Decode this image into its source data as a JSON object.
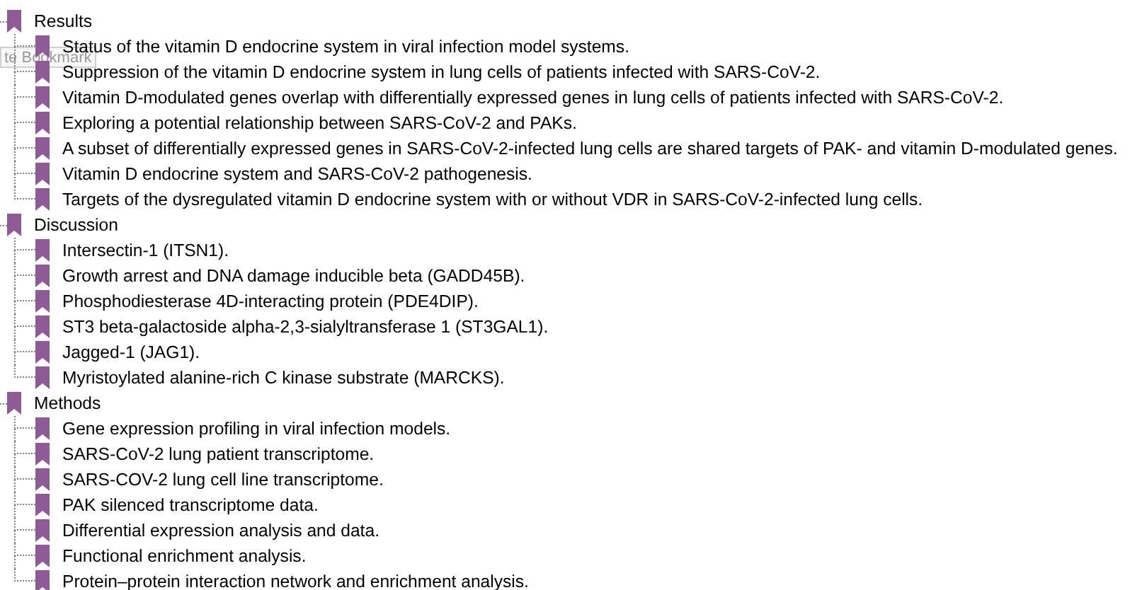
{
  "tooltip": {
    "text": "te Bookmark"
  },
  "bookmarks": [
    {
      "label": "Results",
      "children": [
        {
          "label": "Status of the vitamin D endocrine system in viral infection model systems."
        },
        {
          "label": "Suppression of the vitamin D endocrine system in lung cells of patients infected with SARS-CoV-2."
        },
        {
          "label": "Vitamin D-modulated genes overlap with differentially expressed genes in lung cells of patients infected with SARS-CoV-2."
        },
        {
          "label": "Exploring a potential relationship between SARS-CoV-2 and PAKs."
        },
        {
          "label": "A subset of differentially expressed genes in SARS-CoV-2-infected lung cells are shared targets of PAK- and vitamin D-modulated genes."
        },
        {
          "label": "Vitamin D endocrine system and SARS-CoV-2 pathogenesis."
        },
        {
          "label": "Targets of the dysregulated vitamin D endocrine system with or without VDR in SARS-CoV-2-infected lung cells."
        }
      ]
    },
    {
      "label": "Discussion",
      "children": [
        {
          "label": "Intersectin-1 (ITSN1)."
        },
        {
          "label": "Growth arrest and DNA damage inducible beta (GADD45B)."
        },
        {
          "label": "Phosphodiesterase 4D-interacting protein (PDE4DIP)."
        },
        {
          "label": "ST3 beta-galactoside alpha-2,3-sialyltransferase 1 (ST3GAL1)."
        },
        {
          "label": "Jagged-1 (JAG1)."
        },
        {
          "label": "Myristoylated alanine-rich C kinase substrate (MARCKS)."
        }
      ]
    },
    {
      "label": "Methods",
      "children": [
        {
          "label": "Gene expression profiling in viral infection models."
        },
        {
          "label": "SARS-CoV-2 lung patient transcriptome."
        },
        {
          "label": "SARS-COV-2 lung cell line transcriptome."
        },
        {
          "label": "PAK silenced transcriptome data."
        },
        {
          "label": "Differential expression analysis and data."
        },
        {
          "label": "Functional enrichment analysis."
        },
        {
          "label": "Protein–protein interaction network and enrichment analysis."
        }
      ]
    }
  ]
}
